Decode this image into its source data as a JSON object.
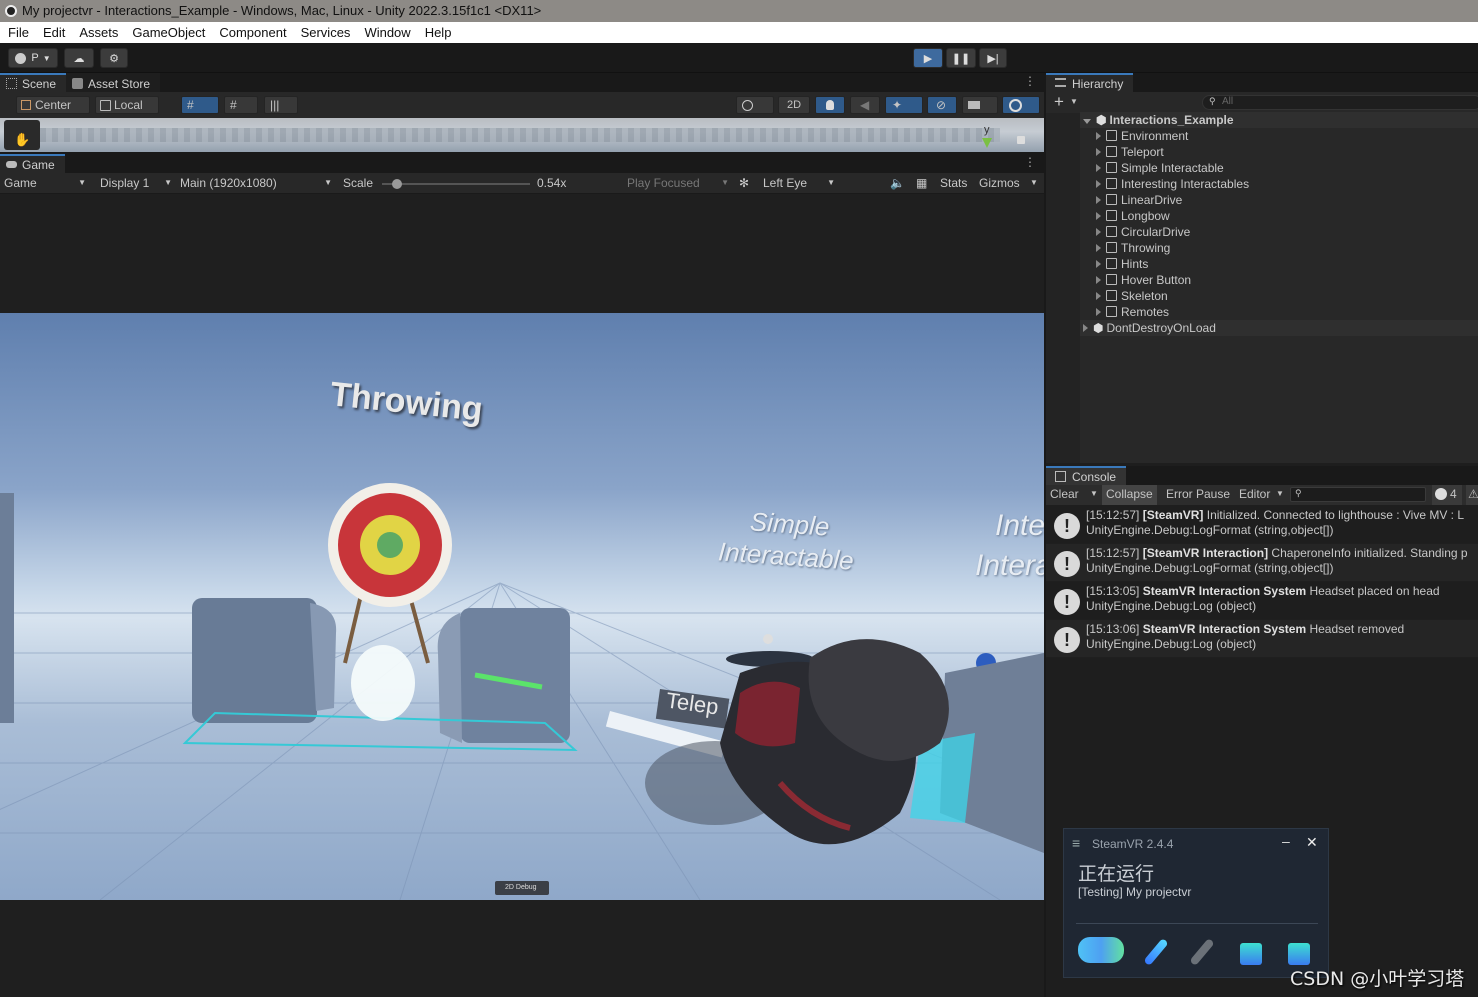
{
  "window": {
    "title": "My projectvr - Interactions_Example - Windows, Mac, Linux - Unity 2022.3.15f1c1 <DX11>"
  },
  "menu": [
    "File",
    "Edit",
    "Assets",
    "GameObject",
    "Component",
    "Services",
    "Window",
    "Help"
  ],
  "toolbar": {
    "account": "P"
  },
  "scene": {
    "tab": "Scene",
    "store_tab": "Asset Store",
    "pivot": "Center",
    "space": "Local",
    "two_d": "2D",
    "axis_y": "y"
  },
  "game": {
    "tab": "Game",
    "mode": "Game",
    "display": "Display 1",
    "resolution": "Main (1920x1080)",
    "scale_label": "Scale",
    "scale_value": "0.54x",
    "scale_fraction": 0.1,
    "play_focused": "Play Focused",
    "eye": "Left Eye",
    "stats": "Stats",
    "gizmos": "Gizmos",
    "scene_labels": {
      "throwing": "Throwing",
      "simple1": "Simple",
      "simple2": "Interactable",
      "inter1": "Inte",
      "inter2": "Intera",
      "teleport": "Telep",
      "debug": "2D Debug"
    }
  },
  "hierarchy": {
    "tab": "Hierarchy",
    "search_placeholder": "All",
    "root": "Interactions_Example",
    "children": [
      "Environment",
      "Teleport",
      "Simple Interactable",
      "Interesting Interactables",
      "LinearDrive",
      "Longbow",
      "CircularDrive",
      "Throwing",
      "Hints",
      "Hover Button",
      "Skeleton",
      "Remotes"
    ],
    "extra": "DontDestroyOnLoad"
  },
  "console": {
    "tab": "Console",
    "clear": "Clear",
    "collapse": "Collapse",
    "error_pause": "Error Pause",
    "editor": "Editor",
    "count": "4",
    "logs": [
      {
        "time": "[15:12:57]",
        "tag": "[SteamVR]",
        "msg": " Initialized. Connected to lighthouse : Vive MV : L",
        "trace": "UnityEngine.Debug:LogFormat (string,object[])"
      },
      {
        "time": "[15:12:57]",
        "tag": "[SteamVR Interaction]",
        "msg": " ChaperoneInfo initialized. Standing p",
        "trace": "UnityEngine.Debug:LogFormat (string,object[])"
      },
      {
        "time": "[15:13:05]",
        "tag": "SteamVR Interaction System",
        "msg": " Headset placed on head",
        "trace": "UnityEngine.Debug:Log (object)"
      },
      {
        "time": "[15:13:06]",
        "tag": "SteamVR Interaction System",
        "msg": " Headset removed",
        "trace": "UnityEngine.Debug:Log (object)"
      }
    ]
  },
  "steamvr": {
    "title": "SteamVR 2.4.4",
    "status": "正在运行",
    "app": "[Testing] My projectvr"
  },
  "watermark": "CSDN @小叶学习塔"
}
